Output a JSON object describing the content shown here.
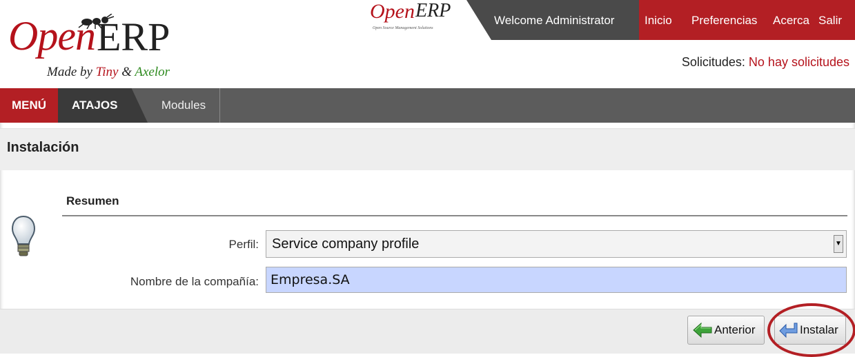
{
  "brand": {
    "logo_open": "Open",
    "logo_erp": "ERP",
    "tagline_prefix": "Made by",
    "tagline_tiny": "Tiny",
    "tagline_amp": "&",
    "tagline_axelor": "Axelor",
    "mini_open": "Open",
    "mini_erp": "ERP",
    "mini_tagline": "Open Source Management Solutions"
  },
  "header": {
    "welcome": "Welcome Administrator",
    "nav": [
      "Inicio",
      "Preferencias",
      "Acerca",
      "Salir"
    ],
    "requests_label": "Solicitudes:",
    "requests_value": "No hay solicitudes"
  },
  "menubar": {
    "menu": "MENÚ",
    "shortcuts": "ATAJOS",
    "modules": "Modules"
  },
  "page": {
    "title": "Instalación"
  },
  "form": {
    "section": "Resumen",
    "perfil_label": "Perfil:",
    "perfil_value": "Service company profile",
    "company_label": "Nombre de la compañía:",
    "company_value": "Empresa.SA"
  },
  "buttons": {
    "back": "Anterior",
    "install": "Instalar"
  },
  "colors": {
    "brand_red": "#b31f24",
    "dark_bar": "#4a4a4a",
    "input_highlight": "#c8d6ff"
  }
}
